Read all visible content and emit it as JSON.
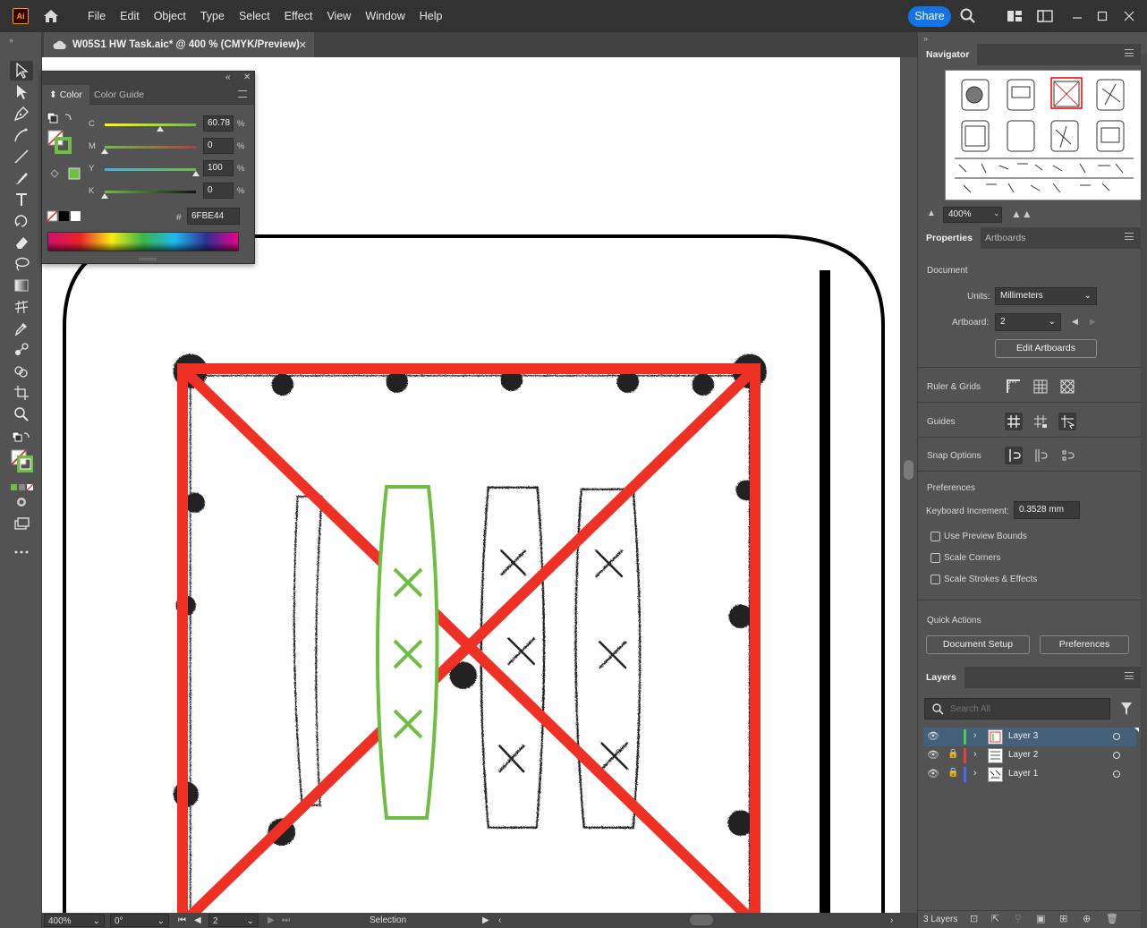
{
  "menubar": {
    "logo": "Ai",
    "menus": [
      "File",
      "Edit",
      "Object",
      "Type",
      "Select",
      "Effect",
      "View",
      "Window",
      "Help"
    ],
    "share": "Share"
  },
  "document": {
    "tab_title": "W05S1 HW Task.aic* @ 400 % (CMYK/Preview)"
  },
  "color_panel": {
    "tabs": [
      "Color",
      "Color Guide"
    ],
    "channels": [
      {
        "label": "C",
        "value": "60.78",
        "level": 0.6078
      },
      {
        "label": "M",
        "value": "0",
        "level": 0
      },
      {
        "label": "Y",
        "value": "100",
        "level": 1.0
      },
      {
        "label": "K",
        "value": "0",
        "level": 0
      }
    ],
    "pct": "%",
    "hash": "#",
    "hex": "6FBE44",
    "fill_color": "#6FBE44"
  },
  "navigator": {
    "title": "Navigator",
    "zoom": "400%"
  },
  "properties": {
    "tabs": [
      "Properties",
      "Artboards"
    ],
    "document_label": "Document",
    "units_label": "Units:",
    "units_value": "Millimeters",
    "artboard_label": "Artboard:",
    "artboard_value": "2",
    "edit_artboards": "Edit Artboards",
    "ruler_grids": "Ruler & Grids",
    "guides": "Guides",
    "snap_options": "Snap Options",
    "preferences_label": "Preferences",
    "keyboard_increment_label": "Keyboard Increment:",
    "keyboard_increment_value": "0.3528 mm",
    "checkboxes": [
      "Use Preview Bounds",
      "Scale Corners",
      "Scale Strokes & Effects"
    ],
    "quick_actions": "Quick Actions",
    "document_setup": "Document Setup",
    "preferences_btn": "Preferences"
  },
  "layers": {
    "title": "Layers",
    "search_placeholder": "Search All",
    "items": [
      {
        "name": "Layer 3",
        "color": "#4fce4f",
        "selected": true
      },
      {
        "name": "Layer 2",
        "color": "#e84040",
        "selected": false
      },
      {
        "name": "Layer 1",
        "color": "#4a6cf0",
        "selected": false
      }
    ],
    "count": "3 Layers"
  },
  "status": {
    "zoom": "400%",
    "rotate": "0°",
    "artboard": "2",
    "tool": "Selection"
  },
  "colors": {
    "red_stroke": "#ee3124",
    "green_stroke": "#6fbe44"
  }
}
